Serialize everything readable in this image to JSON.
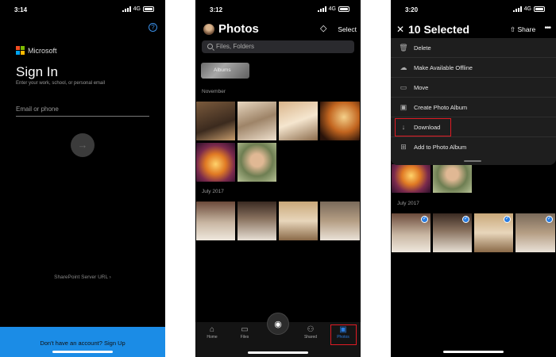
{
  "screen1": {
    "status": {
      "time": "3:14",
      "network": "4G"
    },
    "brand": "Microsoft",
    "title": "Sign In",
    "subtitle": "Enter your work, school, or personal email",
    "email_placeholder": "Email or phone",
    "sharepoint_label": "SharePoint Server URL",
    "signup_text": "Don't have an account? Sign Up",
    "colors": {
      "accent": "#1b8ce6"
    }
  },
  "screen2": {
    "status": {
      "time": "3:12",
      "network": "4G"
    },
    "title": "Photos",
    "select_label": "Select",
    "search_placeholder": "Files, Folders",
    "albums_label": "Albums",
    "sections": [
      "November",
      "July 2017"
    ],
    "nav": [
      {
        "label": "Home",
        "icon": "home-icon"
      },
      {
        "label": "Files",
        "icon": "folder-icon"
      },
      {
        "label": "Shared",
        "icon": "people-icon"
      },
      {
        "label": "Photos",
        "icon": "photo-icon",
        "active": true
      }
    ],
    "camera_icon": "camera-icon"
  },
  "screen3": {
    "status": {
      "time": "3:20",
      "network": "4G"
    },
    "title": "10 Selected",
    "share_label": "Share",
    "menu": [
      {
        "label": "Delete",
        "icon": "trash-icon"
      },
      {
        "label": "Make Available Offline",
        "icon": "cloud-download-icon"
      },
      {
        "label": "Move",
        "icon": "move-icon"
      },
      {
        "label": "Create Photo Album",
        "icon": "album-icon"
      },
      {
        "label": "Download",
        "icon": "download-icon",
        "highlighted": true
      },
      {
        "label": "Add to Photo Album",
        "icon": "add-album-icon"
      }
    ],
    "section": "July 2017"
  }
}
